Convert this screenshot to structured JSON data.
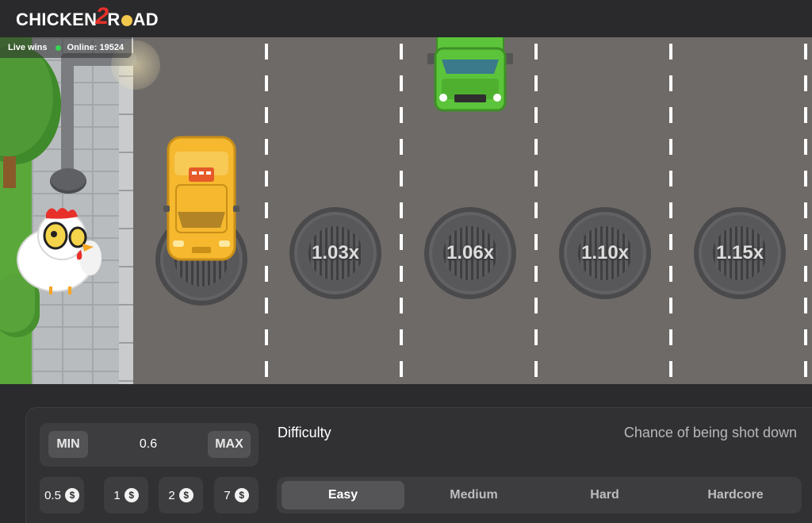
{
  "header": {
    "logo_prefix": "CHICKEN",
    "logo_number": "2",
    "logo_suffix_r": "R",
    "logo_suffix_ad": "AD"
  },
  "live": {
    "wins_label": "Live wins",
    "online_label": "Online: 19524",
    "online_dot_color": "#39d353"
  },
  "board": {
    "multipliers": [
      "1.03x",
      "1.06x",
      "1.10x",
      "1.15x"
    ],
    "vehicles": [
      "taxi",
      "truck"
    ],
    "player": "chicken"
  },
  "bet": {
    "min_label": "MIN",
    "value": "0.6",
    "max_label": "MAX",
    "chips": [
      {
        "amount": "0.5",
        "icon": "$"
      },
      {
        "amount": "1",
        "icon": "$"
      },
      {
        "amount": "2",
        "icon": "$"
      },
      {
        "amount": "7",
        "icon": "$"
      }
    ]
  },
  "difficulty": {
    "label": "Difficulty",
    "chance_label": "Chance of being shot down",
    "options": [
      "Easy",
      "Medium",
      "Hard",
      "Hardcore"
    ],
    "selected": "Easy"
  },
  "colors": {
    "road": "#6e6a67",
    "panel": "#313133",
    "taxi": "#f5b82e",
    "truck": "#5cc43a",
    "logo_accent": "#e8302a"
  }
}
